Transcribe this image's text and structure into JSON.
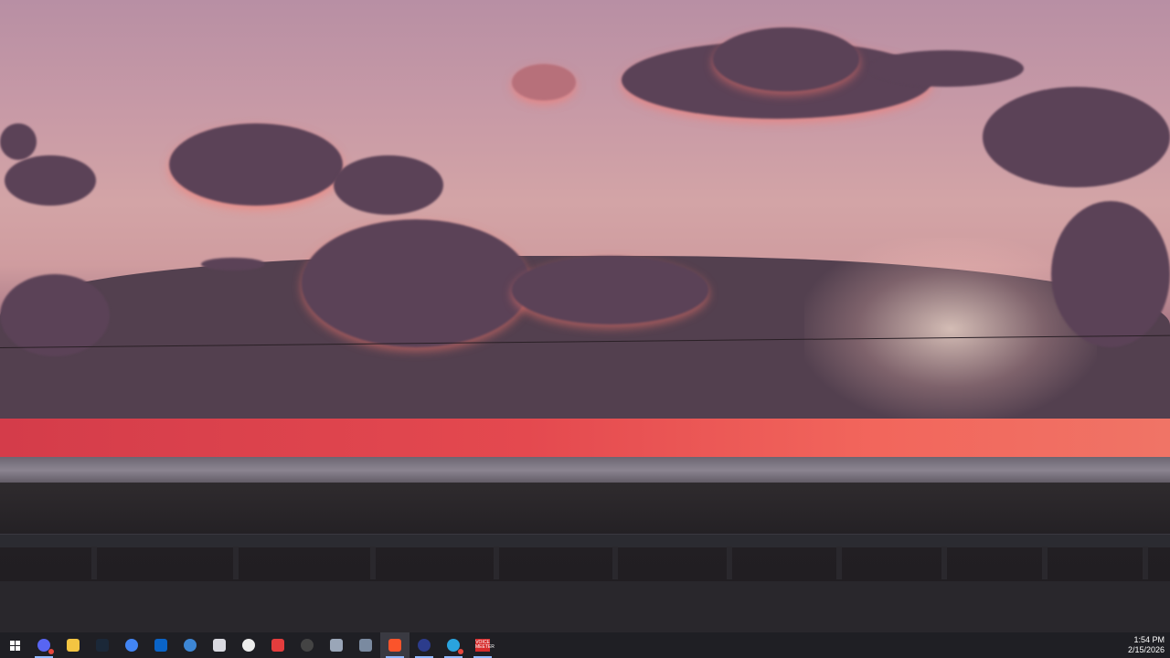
{
  "desktop": {
    "wallpaper": "sunset-over-sea"
  },
  "taskbar": {
    "start": {
      "icon": "windows-start-icon"
    },
    "apps": [
      {
        "name": "discord-icon",
        "color": "#5865f2",
        "running": true,
        "badge": true
      },
      {
        "name": "file-explorer-icon",
        "color": "#f4c542",
        "running": false,
        "badge": false
      },
      {
        "name": "steam-icon",
        "color": "#1b2838",
        "running": false,
        "badge": false
      },
      {
        "name": "chrome-icon",
        "color": "#4285f4",
        "running": false,
        "badge": false
      },
      {
        "name": "outlook-icon",
        "color": "#0a64c8",
        "running": false,
        "badge": false
      },
      {
        "name": "qbittorrent-icon",
        "color": "#3d86d4",
        "running": false,
        "badge": false
      },
      {
        "name": "cloud-app-icon",
        "color": "#d9d9e0",
        "running": false,
        "badge": false
      },
      {
        "name": "eye-app-icon",
        "color": "#ececec",
        "running": false,
        "badge": false
      },
      {
        "name": "red-diamond-app-icon",
        "color": "#e43d3d",
        "running": false,
        "badge": false
      },
      {
        "name": "obs-icon",
        "color": "#444444",
        "running": false,
        "badge": false
      },
      {
        "name": "window-app-icon",
        "color": "#9aa6b8",
        "running": false,
        "badge": false
      },
      {
        "name": "calculator-icon",
        "color": "#7a8aa0",
        "running": false,
        "badge": false
      },
      {
        "name": "brave-icon",
        "color": "#fb542b",
        "running": true,
        "badge": false,
        "active": true
      },
      {
        "name": "media-app-icon",
        "color": "#2c3c8c",
        "running": true,
        "badge": false
      },
      {
        "name": "telegram-icon",
        "color": "#2aa3de",
        "running": true,
        "badge": true
      },
      {
        "name": "voice-meeter-icon",
        "color": "#d62b2b",
        "running": true,
        "badge": false,
        "label_lines": [
          "VOICE",
          "MEETER"
        ]
      }
    ],
    "clock": {
      "time": "1:54 PM",
      "date": "2/15/2026"
    }
  }
}
